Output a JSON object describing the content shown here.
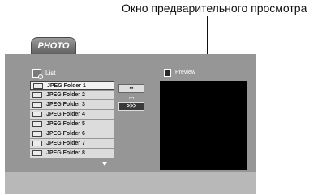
{
  "annotation": {
    "label": "Окно предварительного просмотра"
  },
  "tab": {
    "label": "PHOTO"
  },
  "list": {
    "title": "List",
    "folders": [
      {
        "label": "JPEG Folder 1",
        "selected": true
      },
      {
        "label": "JPEG Folder 2"
      },
      {
        "label": "JPEG Folder 3"
      },
      {
        "label": "JPEG Folder 4"
      },
      {
        "label": "JPEG Folder 5"
      },
      {
        "label": "JPEG Folder 6"
      },
      {
        "label": "JPEG Folder 7"
      },
      {
        "label": "JPEG Folder 8"
      }
    ]
  },
  "controls": {
    "button1": "▪▪",
    "button2": "▭",
    "button3": ">>>"
  },
  "preview": {
    "title": "Preview"
  },
  "icons": {
    "list": "list-icon",
    "folder": "folder-icon",
    "preview": "preview-icon",
    "scroll": "scroll-down-icon"
  }
}
